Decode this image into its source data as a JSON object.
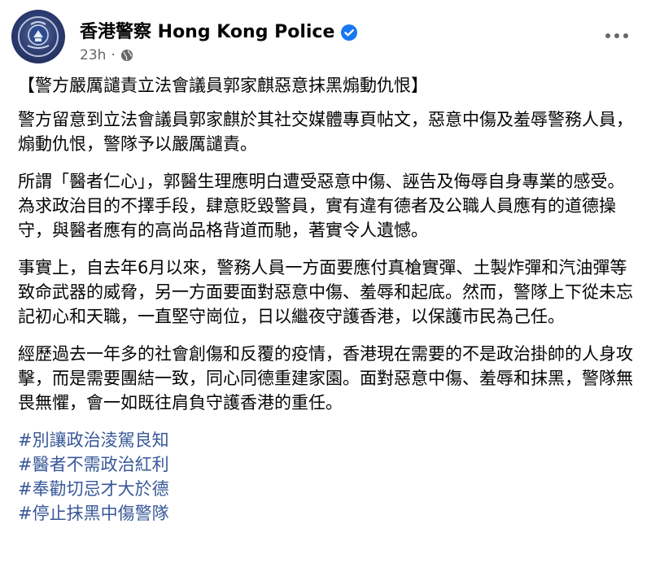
{
  "post": {
    "page_name": "香港警察 Hong Kong Police",
    "timestamp": "23h",
    "title": "【警方嚴厲譴責立法會議員郭家麒惡意抹黑煽動仇恨】",
    "paragraphs": [
      "警方留意到立法會議員郭家麒於其社交媒體專頁帖文，惡意中傷及羞辱警務人員，煽動仇恨，警隊予以嚴厲譴責。",
      "所謂「醫者仁心」，郭醫生理應明白遭受惡意中傷、誣告及侮辱自身專業的感受。為求政治目的不擇手段，肆意貶毀警員，實有違有德者及公職人員應有的道德操守，與醫者應有的高尚品格背道而馳，著實令人遺憾。",
      "事實上，自去年6月以來，警務人員一方面要應付真槍實彈、土製炸彈和汽油彈等致命武器的威脅，另一方面要面對惡意中傷、羞辱和起底。然而，警隊上下從未忘記初心和天職，一直堅守崗位，日以繼夜守護香港，以保護市民為己任。",
      "經歷過去一年多的社會創傷和反覆的疫情，香港現在需要的不是政治掛帥的人身攻擊，而是需要團結一致，同心同德重建家園。面對惡意中傷、羞辱和抹黑，警隊無畏無懼，會一如既往肩負守護香港的重任。"
    ],
    "hashtags": [
      "#別讓政治淩駕良知",
      "#醫者不需政治紅利",
      "#奉勸切忌才大於德",
      "#停止抹黑中傷警隊"
    ],
    "icons": {
      "avatar": "hong-kong-police-badge",
      "verified": "verified-badge-icon",
      "audience": "globe-icon",
      "more": "more-options-icon"
    },
    "colors": {
      "hashtag": "#385898",
      "verified": "#1877f2",
      "meta": "#65676b"
    }
  }
}
